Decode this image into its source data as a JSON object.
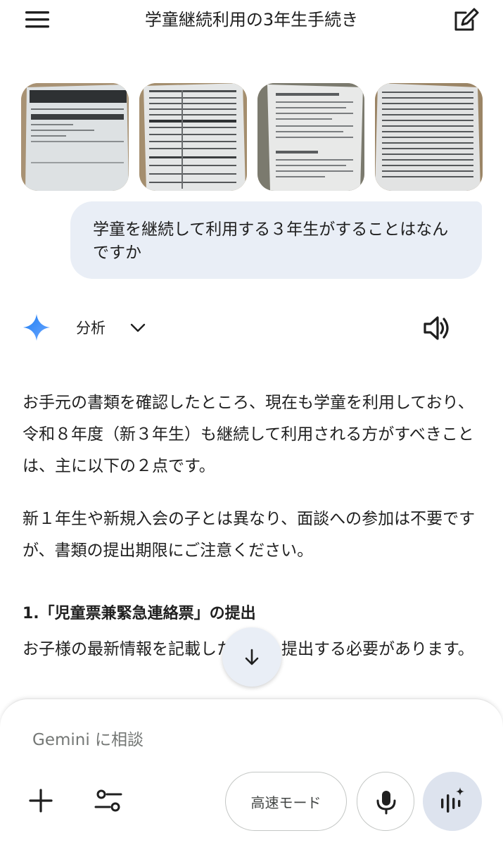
{
  "header": {
    "title": "学童継続利用の3年生手続き",
    "menu_icon": "hamburger-menu-icon",
    "edit_icon": "new-chat-edit-icon"
  },
  "attachments": [
    {
      "kind": "document-photo"
    },
    {
      "kind": "document-photo"
    },
    {
      "kind": "document-photo"
    },
    {
      "kind": "document-photo"
    }
  ],
  "user_message": "学童を継続して利用する３年生がすることはなんですか",
  "response": {
    "model_label": "分析",
    "paragraph_1": "お手元の書類を確認したところ、現在も学童を利用しており、令和８年度（新３年生）も継続して利用される方がすべきことは、主に以下の２点です。",
    "paragraph_2": "新１年生や新規入会の子とは異なり、面談への参加は不要ですが、書類の提出期限にご注意ください。",
    "heading_1": "1.「児童票兼緊急連絡票」の提出",
    "paragraph_3": "お子様の最新情報を記載した書類を提出する必要があります。"
  },
  "composer": {
    "placeholder": "Gemini に相談",
    "mode_label": "高速モード"
  },
  "colors": {
    "bubble": "#e9eef6",
    "accent_blue": "#4285f4",
    "text": "#1f1f1f",
    "placeholder": "#747775"
  }
}
